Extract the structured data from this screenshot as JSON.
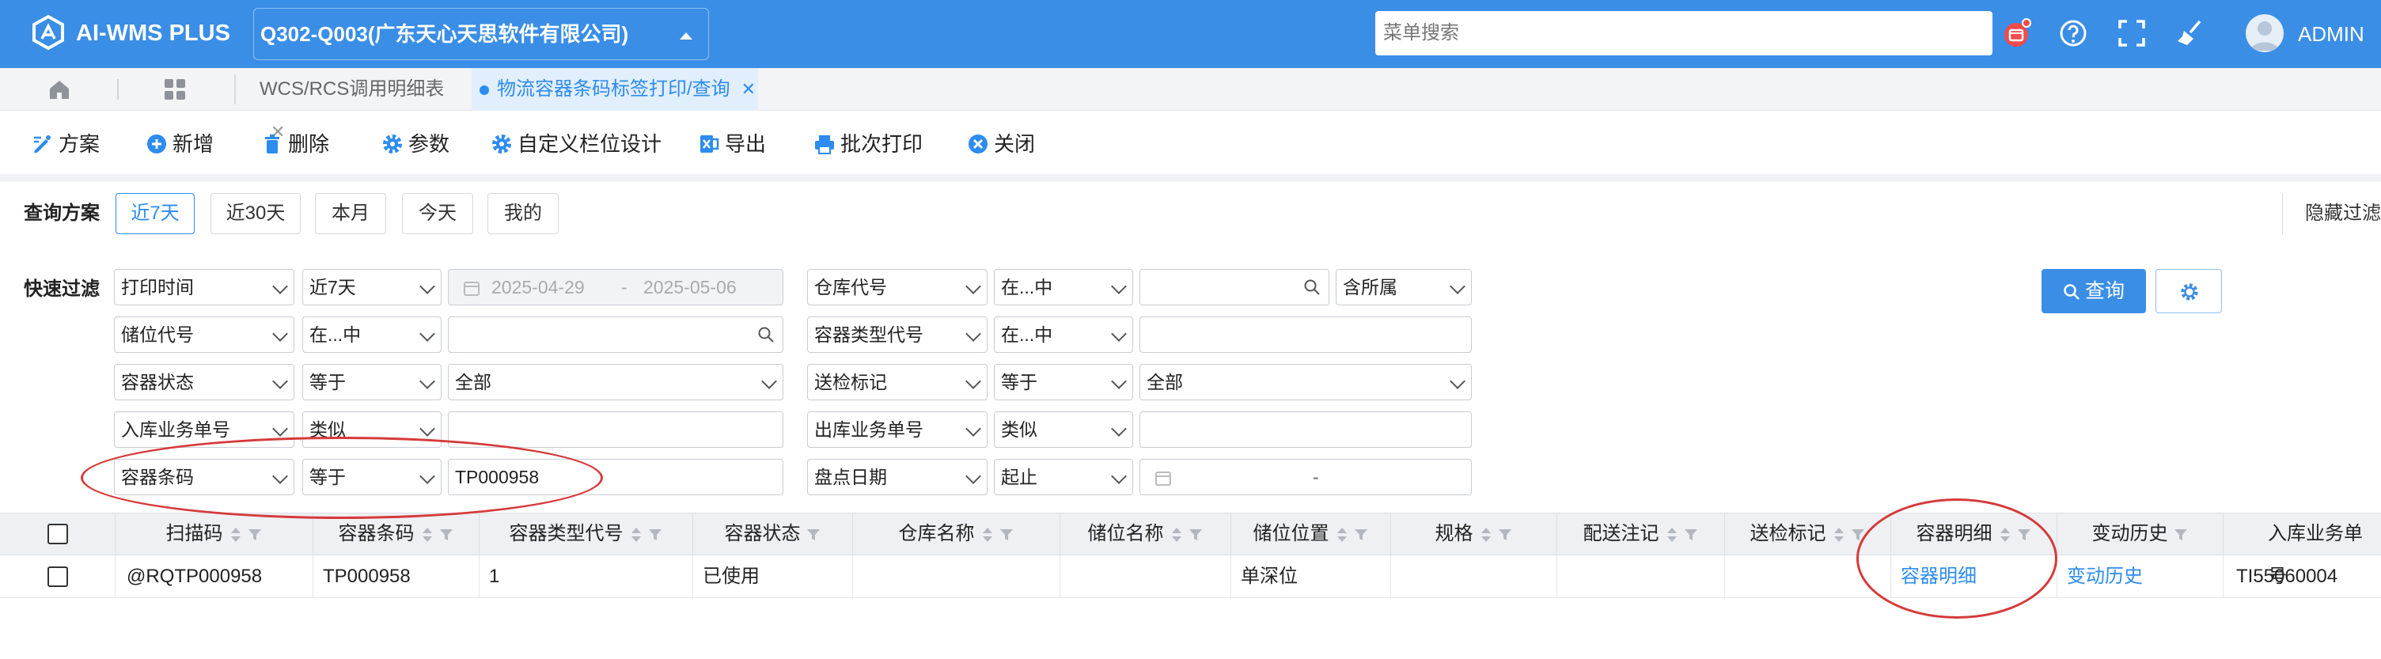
{
  "header": {
    "app_name": "AI-WMS PLUS",
    "org_selector": "Q302-Q003(广东天心天思软件有限公司)",
    "menu_search_placeholder": "菜单搜索",
    "user": "ADMIN",
    "colors": {
      "primary": "#3a8ee6",
      "notice_badge": "#f04b4b"
    },
    "icons": [
      "home-icon",
      "apps-grid-icon",
      "calendar-notice-icon",
      "help-icon",
      "fullscreen-icon",
      "broom-icon",
      "user-avatar-icon"
    ]
  },
  "tabs": [
    {
      "label": "WCS/RCS调用明细表",
      "active": false
    },
    {
      "label": "物流容器条码标签打印/查询",
      "active": true
    }
  ],
  "toolbar": {
    "scheme": "方案",
    "add": "新增",
    "delete": "删除",
    "params": "参数",
    "custom_columns": "自定义栏位设计",
    "export": "导出",
    "batch_print": "批次打印",
    "close": "关闭"
  },
  "query_plan": {
    "label": "查询方案",
    "buttons": [
      "近7天",
      "近30天",
      "本月",
      "今天",
      "我的"
    ],
    "active": "近7天",
    "hide_filter": "隐藏过滤"
  },
  "quick_filter": {
    "label": "快速过滤",
    "left": [
      {
        "field": "打印时间",
        "op": "近7天",
        "date_from": "2025-04-29",
        "date_sep": "-",
        "date_to": "2025-05-06"
      },
      {
        "field": "储位代号",
        "op": "在...中",
        "value": ""
      },
      {
        "field": "容器状态",
        "op": "等于",
        "value": "全部"
      },
      {
        "field": "入库业务单号",
        "op": "类似",
        "value": ""
      },
      {
        "field": "容器条码",
        "op": "等于",
        "value": "TP000958"
      }
    ],
    "right": [
      {
        "field": "仓库代号",
        "op": "在...中",
        "value": "",
        "extra": "含所属"
      },
      {
        "field": "容器类型代号",
        "op": "在...中",
        "value": ""
      },
      {
        "field": "送检标记",
        "op": "等于",
        "value": "全部"
      },
      {
        "field": "出库业务单号",
        "op": "类似",
        "value": ""
      },
      {
        "field": "盘点日期",
        "op": "起止",
        "date_sep": "-"
      }
    ],
    "query_button": "查询"
  },
  "table": {
    "columns": [
      "扫描码",
      "容器条码",
      "容器类型代号",
      "容器状态",
      "仓库名称",
      "储位名称",
      "储位位置",
      "规格",
      "配送注记",
      "送检标记",
      "容器明细",
      "变动历史",
      "入库业务单号"
    ],
    "rows": [
      [
        "@RQTP000958",
        "TP000958",
        "1",
        "已使用",
        "",
        "",
        "单深位",
        "",
        "",
        "",
        "容器明细",
        "变动历史",
        "TI55060004"
      ]
    ],
    "link_color": "#2d8cf0"
  },
  "annotations": {
    "ring_color": "#d63a3a"
  }
}
